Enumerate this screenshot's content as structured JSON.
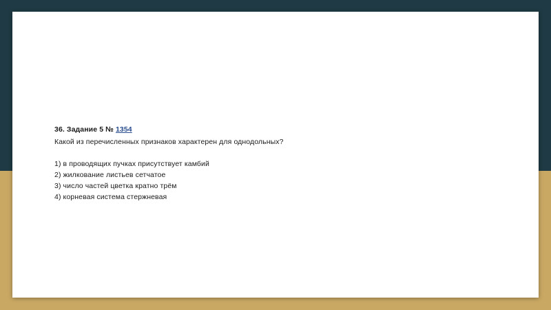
{
  "colors": {
    "top_background": "#1f3a44",
    "bottom_background": "#c9a863",
    "slide_background": "#ffffff",
    "link": "#2a4d8f"
  },
  "task": {
    "heading_prefix": "36. Задание 5 № ",
    "number_link": "1354",
    "question": "Какой из перечисленных признаков характерен для однодольных?",
    "options": [
      "1) в проводящих пучках присутствует камбий",
      "2) жилкование листьев сетчатое",
      "3) число частей цветка кратно трём",
      "4) корневая система стержневая"
    ]
  }
}
